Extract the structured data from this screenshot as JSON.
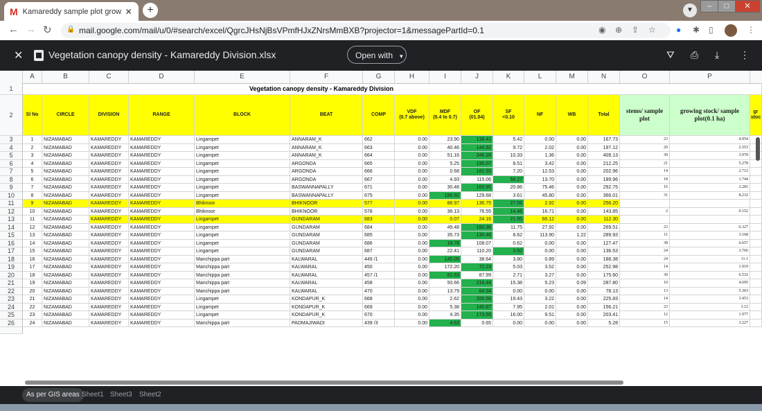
{
  "browser": {
    "tab_title": "Kamareddy sample plot growing",
    "tab_close": "✕",
    "new_tab": "+",
    "url": "mail.google.com/mail/u/0/#search/excel/QgrcJHsNjBsVPmfHJxZNrsMmBXB?projector=1&messagePartId=0.1"
  },
  "viewer": {
    "title": "Vegetation canopy density - Kamareddy Division.xlsx",
    "open_with": "Open with"
  },
  "sheet": {
    "columns": [
      "A",
      "B",
      "C",
      "D",
      "E",
      "F",
      "G",
      "H",
      "I",
      "J",
      "K",
      "L",
      "M",
      "N",
      "O",
      "P"
    ],
    "title": "Vegetation canopy density - Kamareddy Division",
    "header_row": "2",
    "headers": [
      "Sl No",
      "CIRCLE",
      "DIVISION",
      "RANGE",
      "BLOCK",
      "BEAT",
      "COMP",
      "VDF\n(0.7 above)",
      "MDF\n(0.4 to 0.7)",
      "OF\n(01.04)",
      "SF\n<0.10",
      "NF",
      "WB",
      "Total",
      "stems/ sample plot",
      "growing stock/ sample plot(0.1 ha)",
      "gr stoc"
    ],
    "rows": [
      {
        "rn": "3",
        "c": [
          "1",
          "NIZAMABAD",
          "KAMAREDDY",
          "KAMAREDDY",
          "Lingampet",
          "ANNARAM_K",
          "662",
          "0.00",
          "23.90",
          "138.41",
          "5.42",
          "0.00",
          "0.00",
          "167.73",
          "23",
          "4.954"
        ],
        "hl": "",
        "g": [
          9
        ]
      },
      {
        "rn": "4",
        "c": [
          "2",
          "NIZAMABAD",
          "KAMAREDDY",
          "KAMAREDDY",
          "Lingampet",
          "ANNARAM_K",
          "663",
          "0.00",
          "40.46",
          "144.92",
          "9.72",
          "2.02",
          "0.00",
          "197.12",
          "20",
          "2.553"
        ],
        "hl": "",
        "g": [
          9
        ]
      },
      {
        "rn": "5",
        "c": [
          "3",
          "NIZAMABAD",
          "KAMAREDDY",
          "KAMAREDDY",
          "Lingampet",
          "ANNARAM_K",
          "664",
          "0.00",
          "51.16",
          "346.28",
          "10.33",
          "1.36",
          "0.00",
          "409.13",
          "30",
          "3.978"
        ],
        "hl": "",
        "g": [
          9
        ]
      },
      {
        "rn": "6",
        "c": [
          "4",
          "NIZAMABAD",
          "KAMAREDDY",
          "KAMAREDDY",
          "Lingampet",
          "ARGONDA",
          "665",
          "0.00",
          "5.25",
          "195.07",
          "8.51",
          "3.42",
          "0.00",
          "212.25",
          "21",
          "5.278"
        ],
        "hl": "",
        "g": [
          9
        ]
      },
      {
        "rn": "7",
        "c": [
          "5",
          "NIZAMABAD",
          "KAMAREDDY",
          "KAMAREDDY",
          "Lingampet",
          "ARGONDA",
          "666",
          "0.00",
          "0.68",
          "182.55",
          "7.20",
          "12.53",
          "0.00",
          "202.96",
          "14",
          "2.712"
        ],
        "hl": "",
        "g": [
          9
        ]
      },
      {
        "rn": "8",
        "c": [
          "6",
          "NIZAMABAD",
          "KAMAREDDY",
          "KAMAREDDY",
          "Lingampet",
          "ARGONDA",
          "667",
          "0.00",
          "4.93",
          "115.06",
          "56.27",
          "13.70",
          "0.00",
          "189.96",
          "18",
          "1.744"
        ],
        "hl": "",
        "g": [
          10
        ]
      },
      {
        "rn": "9",
        "c": [
          "7",
          "NIZAMABAD",
          "KAMAREDDY",
          "KAMAREDDY",
          "Lingampet",
          "BASWANNAPALLY",
          "671",
          "0.00",
          "30.48",
          "165.95",
          "20.86",
          "75.46",
          "0.00",
          "292.75",
          "16",
          "2.281"
        ],
        "hl": "",
        "g": [
          9
        ]
      },
      {
        "rn": "10",
        "c": [
          "8",
          "NIZAMABAD",
          "KAMAREDDY",
          "KAMAREDDY",
          "Lingampet",
          "BASWANNAPALLY",
          "675",
          "0.00",
          "186.92",
          "129.68",
          "3.61",
          "45.80",
          "0.00",
          "366.01",
          "31",
          "8.232"
        ],
        "hl": "",
        "g": [
          8
        ]
      },
      {
        "rn": "11",
        "c": [
          "9",
          "NIZAMABAD",
          "KAMAREDDY",
          "KAMAREDDY",
          "Bhiknoor",
          "BHIKNOOR",
          "577",
          "0.00",
          "88.97",
          "136.75",
          "27.56",
          "2.92",
          "0.00",
          "256.20",
          "",
          ""
        ],
        "hl": "full",
        "g": [
          10
        ]
      },
      {
        "rn": "12",
        "c": [
          "10",
          "NIZAMABAD",
          "KAMAREDDY",
          "KAMAREDDY",
          "Bhiknoor",
          "BHIKNOOR",
          "578",
          "0.00",
          "36.13",
          "76.55",
          "14.46",
          "16.71",
          "0.00",
          "143.85",
          "2",
          "0.152"
        ],
        "hl": "",
        "g": [
          10
        ]
      },
      {
        "rn": "13",
        "c": [
          "11",
          "NIZAMABAD",
          "KAMAREDDY",
          "KAMAREDDY",
          "Lingampet",
          "GUNDARAM",
          "683",
          "0.00",
          "0.07",
          "24.16",
          "21.95",
          "66.12",
          "0.00",
          "112.30",
          "",
          ""
        ],
        "hl": "part",
        "g": [
          10
        ]
      },
      {
        "rn": "14",
        "c": [
          "12",
          "NIZAMABAD",
          "KAMAREDDY",
          "KAMAREDDY",
          "Lingampet",
          "GUNDARAM",
          "684",
          "0.00",
          "49.48",
          "180.36",
          "11.75",
          "27.92",
          "0.00",
          "269.51",
          "23",
          "6.327"
        ],
        "hl": "",
        "g": [
          9
        ]
      },
      {
        "rn": "15",
        "c": [
          "13",
          "NIZAMABAD",
          "KAMAREDDY",
          "KAMAREDDY",
          "Lingampet",
          "GUNDARAM",
          "685",
          "0.00",
          "35.73",
          "130.46",
          "8.62",
          "113.90",
          "1.22",
          "289.93",
          "11",
          "3.168"
        ],
        "hl": "",
        "g": [
          9
        ]
      },
      {
        "rn": "16",
        "c": [
          "14",
          "NIZAMABAD",
          "KAMAREDDY",
          "KAMAREDDY",
          "Lingampet",
          "GUNDARAM",
          "686",
          "0.00",
          "18.78",
          "108.07",
          "0.62",
          "0.00",
          "0.00",
          "127.47",
          "38",
          "6.657"
        ],
        "hl": "",
        "g": [
          8
        ]
      },
      {
        "rn": "17",
        "c": [
          "15",
          "NIZAMABAD",
          "KAMAREDDY",
          "KAMAREDDY",
          "Lingampet",
          "GUNDARAM",
          "687",
          "0.00",
          "22.41",
          "110.20",
          "3.92",
          "0.00",
          "0.00",
          "136.53",
          "24",
          "3.766"
        ],
        "hl": "",
        "g": [
          10
        ]
      },
      {
        "rn": "18",
        "c": [
          "16",
          "NIZAMABAD",
          "KAMAREDDY",
          "KAMAREDDY",
          "Manchippa part",
          "KALWARAL",
          "449 /1",
          "0.00",
          "145.05",
          "38.64",
          "3.80",
          "0.89",
          "0.00",
          "188.38",
          "24",
          "11.1"
        ],
        "hl": "",
        "g": [
          8
        ]
      },
      {
        "rn": "19",
        "c": [
          "17",
          "NIZAMABAD",
          "KAMAREDDY",
          "KAMAREDDY",
          "Manchippa part",
          "KALWARAL",
          "450",
          "0.00",
          "172.20",
          "72.23",
          "5.03",
          "3.52",
          "0.00",
          "252.98",
          "14",
          "1.919"
        ],
        "hl": "",
        "g": [
          9
        ]
      },
      {
        "rn": "20",
        "c": [
          "18",
          "NIZAMABAD",
          "KAMAREDDY",
          "KAMAREDDY",
          "Manchippa part",
          "KALWARAL",
          "457 /1",
          "0.00",
          "81.63",
          "87.99",
          "2.71",
          "3.27",
          "0.00",
          "175.60",
          "30",
          "6.532"
        ],
        "hl": "",
        "g": [
          8
        ]
      },
      {
        "rn": "21",
        "c": [
          "19",
          "NIZAMABAD",
          "KAMAREDDY",
          "KAMAREDDY",
          "Manchippa part",
          "KALWARAL",
          "458",
          "0.00",
          "50.66",
          "216.44",
          "15.38",
          "5.23",
          "0.09",
          "287.80",
          "10",
          "4.695"
        ],
        "hl": "",
        "g": [
          9
        ]
      },
      {
        "rn": "22",
        "c": [
          "20",
          "NIZAMABAD",
          "KAMAREDDY",
          "KAMAREDDY",
          "Manchippa part",
          "KALWARAL",
          "470",
          "0.00",
          "13.79",
          "64.34",
          "0.00",
          "0.00",
          "0.00",
          "78.13",
          "13",
          "5.303"
        ],
        "hl": "",
        "g": [
          9
        ]
      },
      {
        "rn": "23",
        "c": [
          "21",
          "NIZAMABAD",
          "KAMAREDDY",
          "KAMAREDDY",
          "Lingampet",
          "KONDAPUR_K",
          "668",
          "0.00",
          "2.62",
          "200.56",
          "19.43",
          "3.22",
          "0.00",
          "225.83",
          "14",
          "3.453"
        ],
        "hl": "",
        "g": [
          9
        ]
      },
      {
        "rn": "24",
        "c": [
          "22",
          "NIZAMABAD",
          "KAMAREDDY",
          "KAMAREDDY",
          "Lingampet",
          "KONDAPUR_K",
          "669",
          "0.00",
          "5.38",
          "140.87",
          "7.95",
          "2.01",
          "0.00",
          "156.21",
          "23",
          "3.12"
        ],
        "hl": "",
        "g": [
          9
        ]
      },
      {
        "rn": "25",
        "c": [
          "23",
          "NIZAMABAD",
          "KAMAREDDY",
          "KAMAREDDY",
          "Lingampet",
          "KONDAPUR_K",
          "670",
          "0.00",
          "4.35",
          "173.55",
          "16.00",
          "9.51",
          "0.00",
          "203.41",
          "12",
          "1.977"
        ],
        "hl": "",
        "g": [
          9
        ]
      },
      {
        "rn": "26",
        "c": [
          "24",
          "NIZAMABAD",
          "KAMAREDDY",
          "KAMAREDDY",
          "Manchippa part",
          "PADMAJIWADI",
          "439 /3",
          "0.00",
          "4.63",
          "0.65",
          "0.00",
          "0.00",
          "0.00",
          "5.28",
          "15",
          "3.227"
        ],
        "hl": "",
        "g": [
          8
        ]
      }
    ],
    "sheet_tabs": [
      "As per GIS areas",
      "Sheet1",
      "Sheet3",
      "Sheet2"
    ]
  },
  "colors": {
    "highlight": "#ffff00",
    "green": "#22b14c",
    "header_green": "#ccffcc",
    "header_yellow": "#ffff00"
  }
}
